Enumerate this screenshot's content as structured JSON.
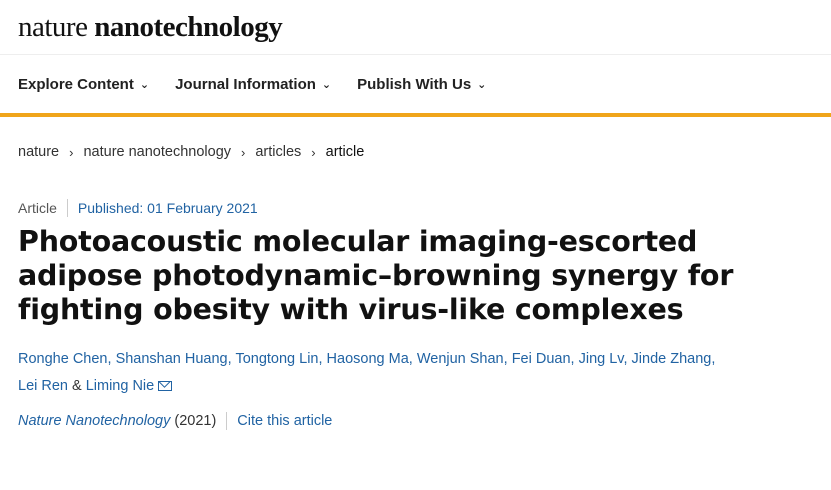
{
  "logo": {
    "part1": "nature",
    "part2": "nanotechnology"
  },
  "nav": {
    "items": [
      {
        "label": "Explore Content"
      },
      {
        "label": "Journal Information"
      },
      {
        "label": "Publish With Us"
      }
    ]
  },
  "breadcrumb": {
    "items": [
      "nature",
      "nature nanotechnology",
      "articles",
      "article"
    ]
  },
  "article": {
    "type": "Article",
    "published": "Published: 01 February 2021",
    "title": "Photoacoustic molecular imaging-escorted adipose photodynamic–browning synergy for fighting obesity with virus-like complexes",
    "authors": [
      "Ronghe Chen",
      "Shanshan Huang",
      "Tongtong Lin",
      "Haosong Ma",
      "Wenjun Shan",
      "Fei Duan",
      "Jing Lv",
      "Jinde Zhang",
      "Lei Ren",
      "Liming Nie"
    ],
    "author_sep": ", ",
    "author_amp": " & ",
    "journal": "Nature Nanotechnology",
    "year": "(2021)",
    "cite_label": "Cite this article"
  },
  "colors": {
    "accent": "#f0a51a",
    "link": "#2163a3"
  },
  "icons": {
    "nav_chevron": "chevron-down-icon",
    "crumb_sep": "chevron-right-icon",
    "corresponding": "mail-icon"
  }
}
